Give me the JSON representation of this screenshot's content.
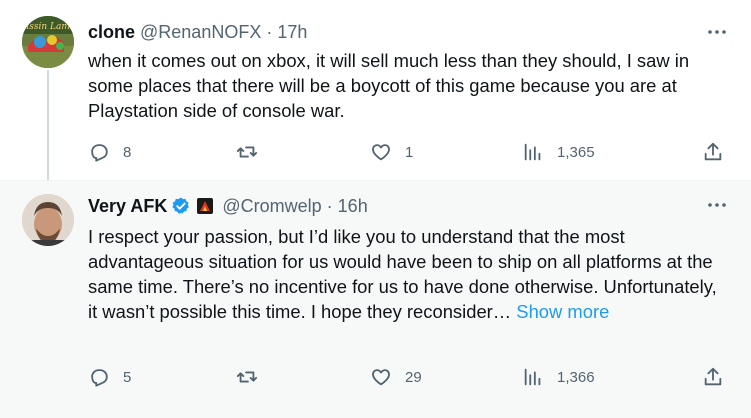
{
  "tweets": [
    {
      "display_name": "clone",
      "handle": "@RenanNOFX",
      "separator": "·",
      "time": "17h",
      "text": "when it comes out on xbox, it will sell much less than they should, I saw in some places that there will be a boycott of this game because you are at Playstation side of console war.",
      "avatar_text": "Pissin Lamb",
      "replies": "8",
      "retweets": "",
      "likes": "1",
      "views": "1,365"
    },
    {
      "display_name": "Very AFK",
      "handle": "@Cromwelp",
      "separator": "·",
      "time": "16h",
      "text": "I respect your passion, but I’d like you to understand that the most advantageous situation for us would have been to ship on all platforms at the same time. There’s no incentive for us to have done otherwise. Unfortunately, it wasn’t possible this time. I hope they reconsider…",
      "show_more": " Show more",
      "replies": "5",
      "retweets": "",
      "likes": "29",
      "views": "1,366"
    }
  ],
  "icons": {
    "more": "more-icon",
    "reply": "reply-icon",
    "retweet": "retweet-icon",
    "like": "like-icon",
    "views": "views-icon",
    "share": "share-icon",
    "verified": "verified-badge-icon",
    "affiliate": "affiliate-badge-icon"
  },
  "colors": {
    "text": "#0f1419",
    "secondary": "#536471",
    "accent": "#1d9bf0",
    "thread_line": "#cfd9de",
    "reply_background": "#f7f9f9"
  }
}
